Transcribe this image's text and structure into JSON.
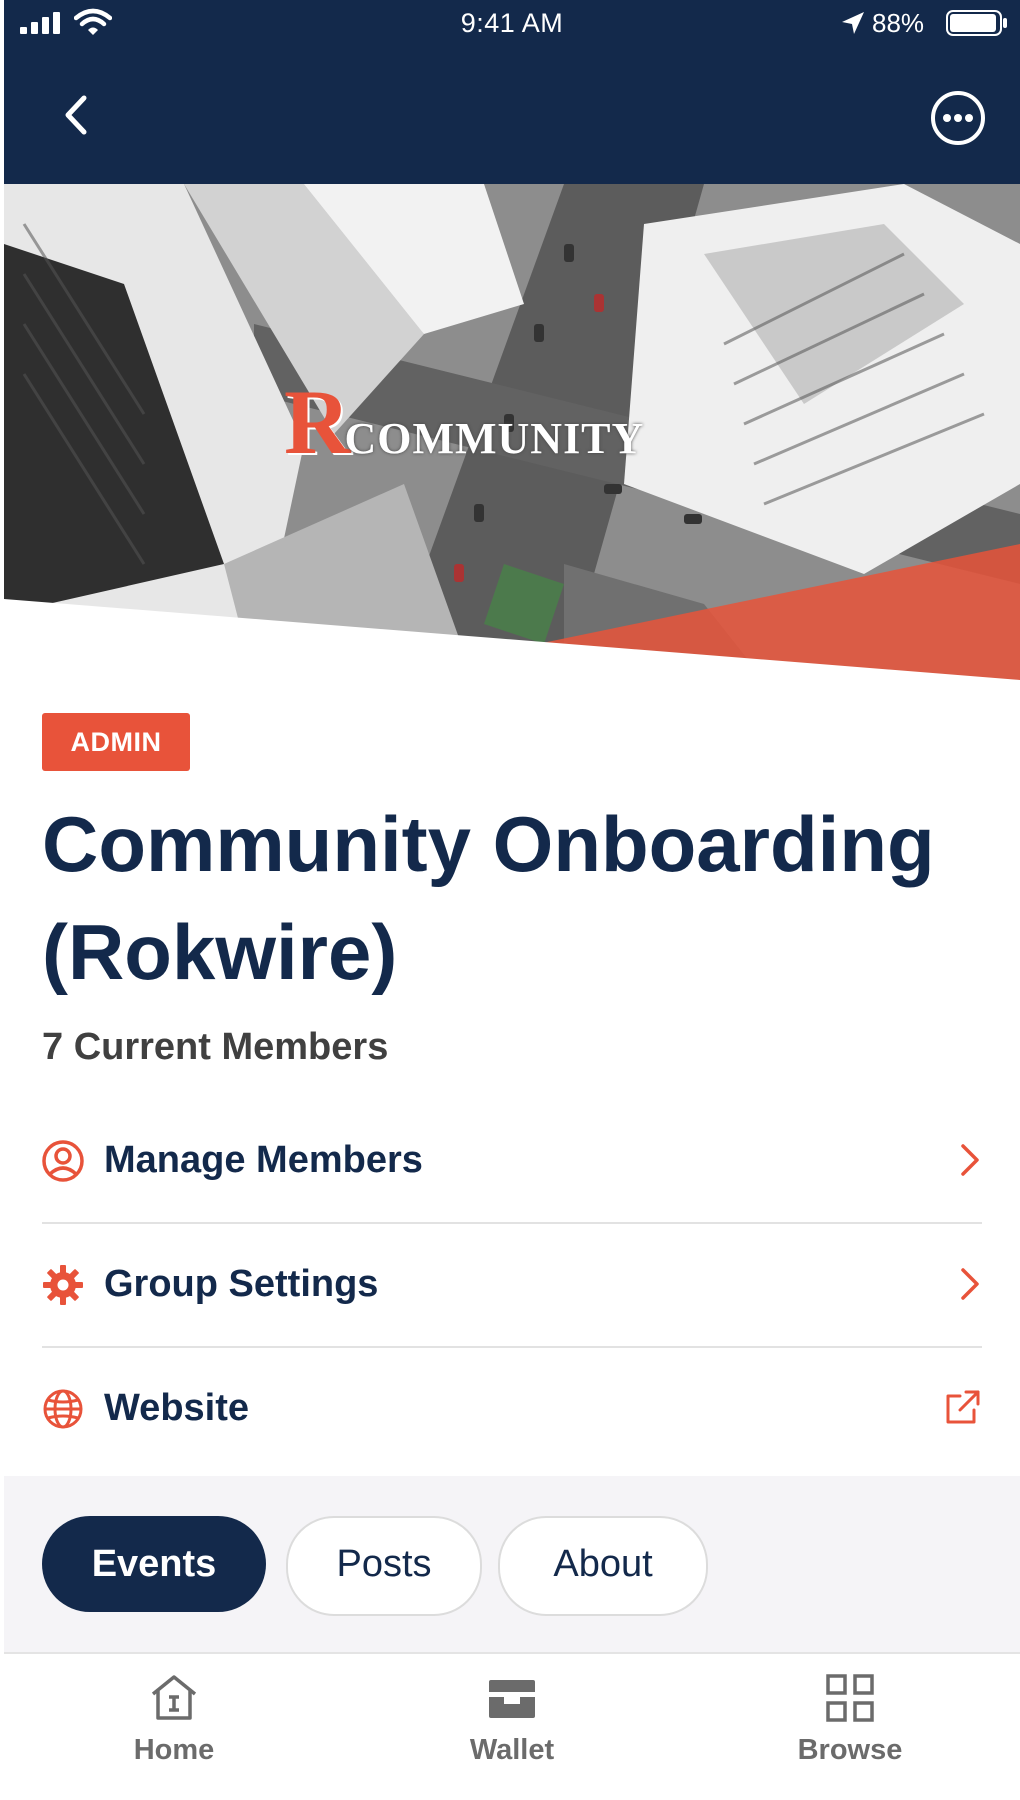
{
  "status_bar": {
    "time": "9:41 AM",
    "battery_percent": "88%"
  },
  "nav": {
    "back_icon": "chevron-left-icon",
    "more_icon": "more-horizontal-circle-icon"
  },
  "hero": {
    "logo_letter": "R",
    "logo_word": "COMMUNITY"
  },
  "group": {
    "badge": "ADMIN",
    "title": "Community Onboarding (Rokwire)",
    "members_text": "7 Current Members"
  },
  "actions": [
    {
      "label": "Manage Members",
      "icon": "person-circle-icon",
      "trailing": "chevron-right-icon"
    },
    {
      "label": "Group Settings",
      "icon": "gear-icon",
      "trailing": "chevron-right-icon"
    },
    {
      "label": "Website",
      "icon": "globe-icon",
      "trailing": "external-link-icon"
    }
  ],
  "tabs": [
    {
      "label": "Events",
      "active": true
    },
    {
      "label": "Posts",
      "active": false
    },
    {
      "label": "About",
      "active": false
    }
  ],
  "bottom_nav": [
    {
      "label": "Home",
      "icon": "home-icon"
    },
    {
      "label": "Wallet",
      "icon": "wallet-icon"
    },
    {
      "label": "Browse",
      "icon": "grid-icon"
    }
  ],
  "colors": {
    "navy": "#13294b",
    "accent": "#e8533a",
    "text_gray": "#404040",
    "nav_gray": "#6b6b6b"
  }
}
